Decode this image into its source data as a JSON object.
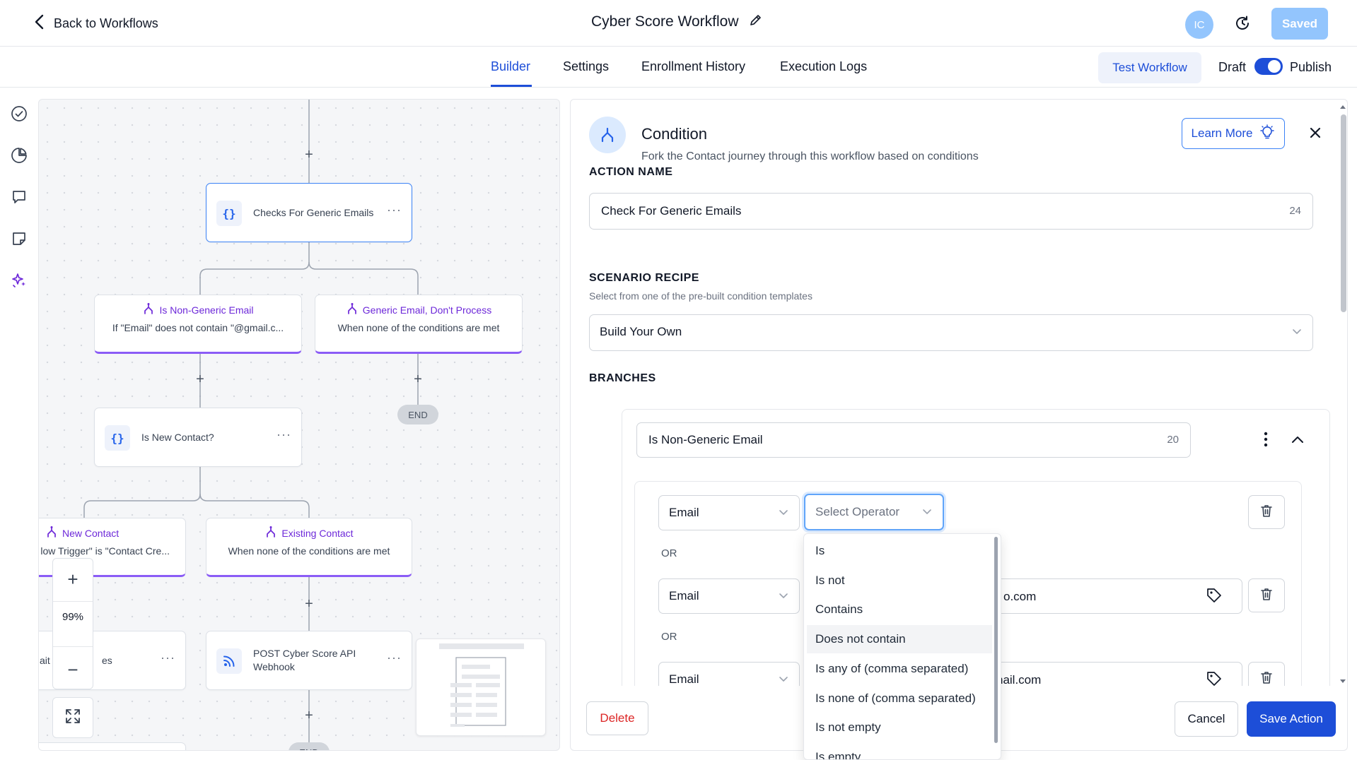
{
  "header": {
    "back_label": "Back to Workflows",
    "workflow_title": "Cyber Score Workflow",
    "avatar_initials": "IC",
    "saved_label": "Saved"
  },
  "tabs": {
    "builder": "Builder",
    "settings": "Settings",
    "enrollment_history": "Enrollment History",
    "execution_logs": "Execution Logs",
    "test_workflow": "Test Workflow",
    "draft": "Draft",
    "publish": "Publish",
    "publish_toggle_on": true
  },
  "canvas": {
    "node_checks_generic": "Checks For Generic Emails",
    "branch_non_generic_title": "Is Non-Generic Email",
    "branch_non_generic_sub": "If \"Email\" does not contain \"@gmail.c...",
    "branch_generic_title": "Generic Email, Don't Process",
    "branch_generic_sub": "When none of the conditions are met",
    "end_label": "END",
    "node_is_new_contact": "Is New Contact?",
    "branch_new_contact_title": "New Contact",
    "branch_new_contact_sub": "low Trigger\" is \"Contact Cre...",
    "branch_existing_title": "Existing Contact",
    "branch_existing_sub": "When none of the conditions are met",
    "node_partial_left_a": "ait",
    "node_partial_left_b": "es",
    "node_post_webhook": "POST Cyber Score API Webhook",
    "zoom_value": "99%",
    "end_label_bottom": "END"
  },
  "panel": {
    "title": "Condition",
    "subtitle": "Fork the Contact journey through this workflow based on conditions",
    "learn_more": "Learn More",
    "action_name_label": "ACTION NAME",
    "action_name_value": "Check For Generic Emails",
    "action_name_count": "24",
    "scenario_label": "SCENARIO RECIPE",
    "scenario_help": "Select from one of the pre-built condition templates",
    "scenario_value": "Build Your Own",
    "branches_label": "BRANCHES",
    "branch_name_value": "Is Non-Generic Email",
    "branch_name_count": "20",
    "conditions": [
      {
        "field": "Email",
        "operator_placeholder": "Select Operator"
      },
      {
        "field": "Email",
        "value_partial": "o.com"
      },
      {
        "field": "Email",
        "value_partial": "nail.com"
      }
    ],
    "or_label": "OR",
    "delete": "Delete",
    "cancel": "Cancel",
    "save_action": "Save Action"
  },
  "operator_dropdown": {
    "options": [
      "Is",
      "Is not",
      "Contains",
      "Does not contain",
      "Is any of (comma separated)",
      "Is none of (comma separated)",
      "Is not empty",
      "Is empty"
    ],
    "hovered": "Does not contain"
  },
  "colors": {
    "primary": "#1d4ed8",
    "branch_accent": "#8b5cf6",
    "danger": "#dc2626",
    "saved_disabled": "#93c5fd"
  }
}
